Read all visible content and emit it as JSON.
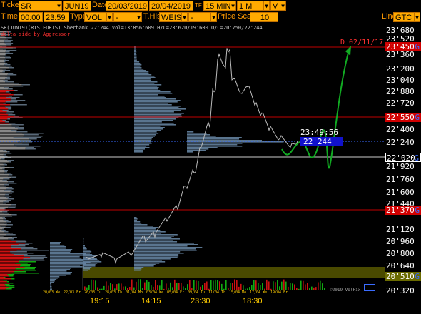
{
  "toolbar1": {
    "ticker_label": "Ticker",
    "ticker_value": "SR",
    "contract_value": "JUN19",
    "date_label": "Date",
    "date_from": "20/03/2019",
    "date_to": "20/04/2019",
    "tf_label": "TF",
    "tf_value": "15 MIN",
    "range_value": "1 M",
    "mode_value": "V"
  },
  "toolbar2": {
    "time_label": "Time",
    "time_from": "00:00",
    "time_to": "23:59",
    "type_label": "Type",
    "type_value": "VOL",
    "type2_value": "-",
    "thist_label": "T.Hist",
    "thist_value": "WEIS V",
    "thist2_value": "-",
    "price_scale_label": "Price Scale",
    "price_scale_value": "10",
    "line_label": "Line",
    "line_value": "GTC"
  },
  "chart_header": {
    "info": "SR(JUN19)(RTS FORTS) Sberbank  22'244  Vol=13'856'609  H/L=23'620/19'600  O/C=20'750/22'244",
    "delta": "delta side by Aggressor"
  },
  "price_axis": [
    "23'680",
    "23'520",
    "23'360",
    "23'200",
    "23'040",
    "22'880",
    "22'720",
    "22'400",
    "22'240",
    "21'920",
    "21'760",
    "21'600",
    "21'440",
    "21'120",
    "20'960",
    "20'800",
    "20'640",
    "20'320"
  ],
  "markers": {
    "m1": {
      "price": "23'450",
      "flag": "G"
    },
    "m2": {
      "price": "22'550",
      "flag": "G"
    },
    "m3": {
      "price": "22'020",
      "flag": "G"
    },
    "m4": {
      "price": "21'370",
      "flag": "G"
    },
    "m5": {
      "price": "20'510",
      "flag": "G"
    }
  },
  "annotation": "D 02/11/17",
  "clock": "23:49:56",
  "last_price": "22'244",
  "copyright": "©2019 VolFix",
  "time_labels": [
    "19:15",
    "14:15",
    "23:30",
    "18:30"
  ],
  "date_labels": [
    "20/03 We",
    "22/03 Fr",
    "26/03 Tu",
    "28/03 Th",
    "01/04 Mo",
    "03/04 We",
    "05/04 Fr",
    "09/04 Tu",
    "11/04 Th",
    "15/04 Mo",
    "17/04 We",
    "19/04 Fr"
  ],
  "colors": {
    "accent": "#ffaa00",
    "axis_bg": "#000000",
    "red_line": "#c00000",
    "blue_flag": "#3a6cff",
    "profile_fill": "#6a8aa8",
    "sell_bar": "#cc1111",
    "buy_bar": "#11aa11"
  }
}
